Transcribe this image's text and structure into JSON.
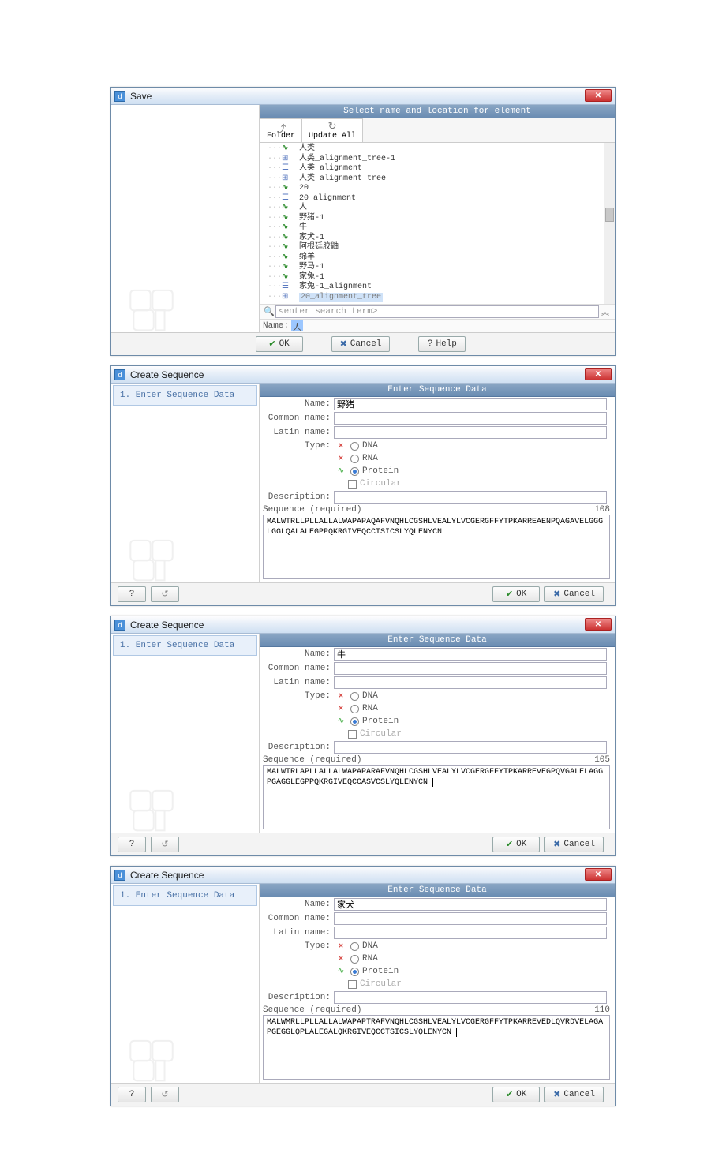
{
  "save_dialog": {
    "title": "Save",
    "section_header": "Select name and location for element",
    "tabs": {
      "folder": "Folder",
      "update": "Update All"
    },
    "tree": [
      {
        "icon": "seq",
        "label": "人类"
      },
      {
        "icon": "tre",
        "label": "人类_alignment_tree-1"
      },
      {
        "icon": "aln",
        "label": "人类_alignment"
      },
      {
        "icon": "tre",
        "label": "人类 alignment tree"
      },
      {
        "icon": "seq",
        "label": "20"
      },
      {
        "icon": "aln",
        "label": "20_alignment"
      },
      {
        "icon": "seq",
        "label": "人"
      },
      {
        "icon": "seq",
        "label": "野猪-1"
      },
      {
        "icon": "seq",
        "label": "牛"
      },
      {
        "icon": "seq",
        "label": "家犬-1"
      },
      {
        "icon": "seq",
        "label": "阿根廷胶鼬"
      },
      {
        "icon": "seq",
        "label": "绵羊"
      },
      {
        "icon": "seq",
        "label": "野马-1"
      },
      {
        "icon": "seq",
        "label": "家兔-1"
      },
      {
        "icon": "aln",
        "label": "家兔-1_alignment"
      },
      {
        "icon": "tre",
        "label": "20_alignment_tree",
        "sel": true
      }
    ],
    "search_placeholder": "<enter search term>",
    "name_label": "Name:",
    "name_value": "人",
    "buttons": {
      "ok": "OK",
      "cancel": "Cancel",
      "help": "Help"
    }
  },
  "seq_dialogs": [
    {
      "title": "Create Sequence",
      "step_label": "1. Enter Sequence Data",
      "section_header": "Enter Sequence Data",
      "fields": {
        "name_label": "Name:",
        "name_value": "野猪",
        "common_label": "Common name:",
        "common_value": "",
        "latin_label": "Latin name:",
        "latin_value": "",
        "type_label": "Type:",
        "types": {
          "dna": "DNA",
          "rna": "RNA",
          "protein": "Protein"
        },
        "selected_type": "protein",
        "circular_label": "Circular",
        "desc_label": "Description:",
        "desc_value": "",
        "seq_label": "Sequence (required)",
        "seq_count": "108",
        "sequence": "MALWTRLLPLLALLALWAPAPAQAFVNQHLCGSHLVEALYLVCGERGFFYTPKARREAENPQAGAVELGGGLGGLQALALEGPPQKRGIVEQCCTSICSLYQLENYCN"
      },
      "buttons": {
        "ok": "OK",
        "cancel": "Cancel",
        "help": "?"
      }
    },
    {
      "title": "Create Sequence",
      "step_label": "1. Enter Sequence Data",
      "section_header": "Enter Sequence Data",
      "fields": {
        "name_label": "Name:",
        "name_value": "牛",
        "common_label": "Common name:",
        "common_value": "",
        "latin_label": "Latin name:",
        "latin_value": "",
        "type_label": "Type:",
        "types": {
          "dna": "DNA",
          "rna": "RNA",
          "protein": "Protein"
        },
        "selected_type": "protein",
        "circular_label": "Circular",
        "desc_label": "Description:",
        "desc_value": "",
        "seq_label": "Sequence (required)",
        "seq_count": "105",
        "sequence": "MALWTRLAPLLALLALWAPAPARAFVNQHLCGSHLVEALYLVCGERGFFYTPKARREVEGPQVGALELAGGPGAGGLEGPPQKRGIVEQCCASVCSLYQLENYCN"
      },
      "buttons": {
        "ok": "OK",
        "cancel": "Cancel",
        "help": "?"
      }
    },
    {
      "title": "Create Sequence",
      "step_label": "1. Enter Sequence Data",
      "section_header": "Enter Sequence Data",
      "fields": {
        "name_label": "Name:",
        "name_value": "家犬",
        "common_label": "Common name:",
        "common_value": "",
        "latin_label": "Latin name:",
        "latin_value": "",
        "type_label": "Type:",
        "types": {
          "dna": "DNA",
          "rna": "RNA",
          "protein": "Protein"
        },
        "selected_type": "protein",
        "circular_label": "Circular",
        "desc_label": "Description:",
        "desc_value": "",
        "seq_label": "Sequence (required)",
        "seq_count": "110",
        "sequence": "MALWMRLLPLLALLALWAPAPTRAFVNQHLCGSHLVEALYLVCGERGFFYTPKARREVEDLQVRDVELAGAPGEGGLQPLALEGALQKRGIVEQCCTSICSLYQLENYCN"
      },
      "buttons": {
        "ok": "OK",
        "cancel": "Cancel",
        "help": "?"
      }
    }
  ]
}
